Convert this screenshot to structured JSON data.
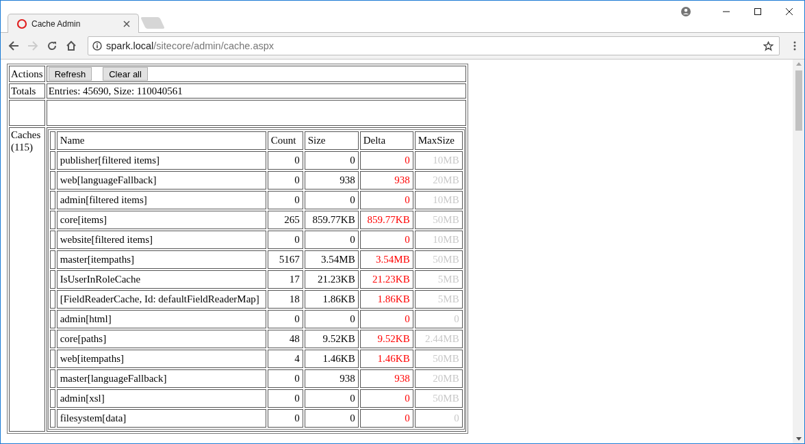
{
  "browser": {
    "tabs": [
      {
        "title": "Cache Admin",
        "selected": true
      }
    ],
    "forward_disabled": true,
    "address": {
      "host": "spark.local",
      "path": "/sitecore/admin/cache.aspx"
    }
  },
  "actions": {
    "label": "Actions",
    "buttons": [
      "Refresh",
      "Clear all"
    ]
  },
  "totals": {
    "label": "Totals",
    "text": "Entries: 45690, Size: 110040561"
  },
  "caches": {
    "label": "Caches (115)",
    "columns": [
      "Name",
      "Count",
      "Size",
      "Delta",
      "MaxSize"
    ],
    "rows": [
      {
        "name": "publisher[filtered items]",
        "count": "0",
        "size": "0",
        "delta": "0",
        "max_size": "10MB"
      },
      {
        "name": "web[languageFallback]",
        "count": "0",
        "size": "938",
        "delta": "938",
        "max_size": "20MB"
      },
      {
        "name": "admin[filtered items]",
        "count": "0",
        "size": "0",
        "delta": "0",
        "max_size": "10MB"
      },
      {
        "name": "core[items]",
        "count": "265",
        "size": "859.77KB",
        "delta": "859.77KB",
        "max_size": "50MB"
      },
      {
        "name": "website[filtered items]",
        "count": "0",
        "size": "0",
        "delta": "0",
        "max_size": "10MB"
      },
      {
        "name": "master[itempaths]",
        "count": "5167",
        "size": "3.54MB",
        "delta": "3.54MB",
        "max_size": "50MB"
      },
      {
        "name": "IsUserInRoleCache",
        "count": "17",
        "size": "21.23KB",
        "delta": "21.23KB",
        "max_size": "5MB"
      },
      {
        "name": "[FieldReaderCache, Id: defaultFieldReaderMap]",
        "count": "18",
        "size": "1.86KB",
        "delta": "1.86KB",
        "max_size": "5MB"
      },
      {
        "name": "admin[html]",
        "count": "0",
        "size": "0",
        "delta": "0",
        "max_size": "0"
      },
      {
        "name": "core[paths]",
        "count": "48",
        "size": "9.52KB",
        "delta": "9.52KB",
        "max_size": "2.44MB"
      },
      {
        "name": "web[itempaths]",
        "count": "4",
        "size": "1.46KB",
        "delta": "1.46KB",
        "max_size": "50MB"
      },
      {
        "name": "master[languageFallback]",
        "count": "0",
        "size": "938",
        "delta": "938",
        "max_size": "20MB"
      },
      {
        "name": "admin[xsl]",
        "count": "0",
        "size": "0",
        "delta": "0",
        "max_size": "50MB"
      },
      {
        "name": "filesystem[data]",
        "count": "0",
        "size": "0",
        "delta": "0",
        "max_size": "0"
      }
    ]
  }
}
